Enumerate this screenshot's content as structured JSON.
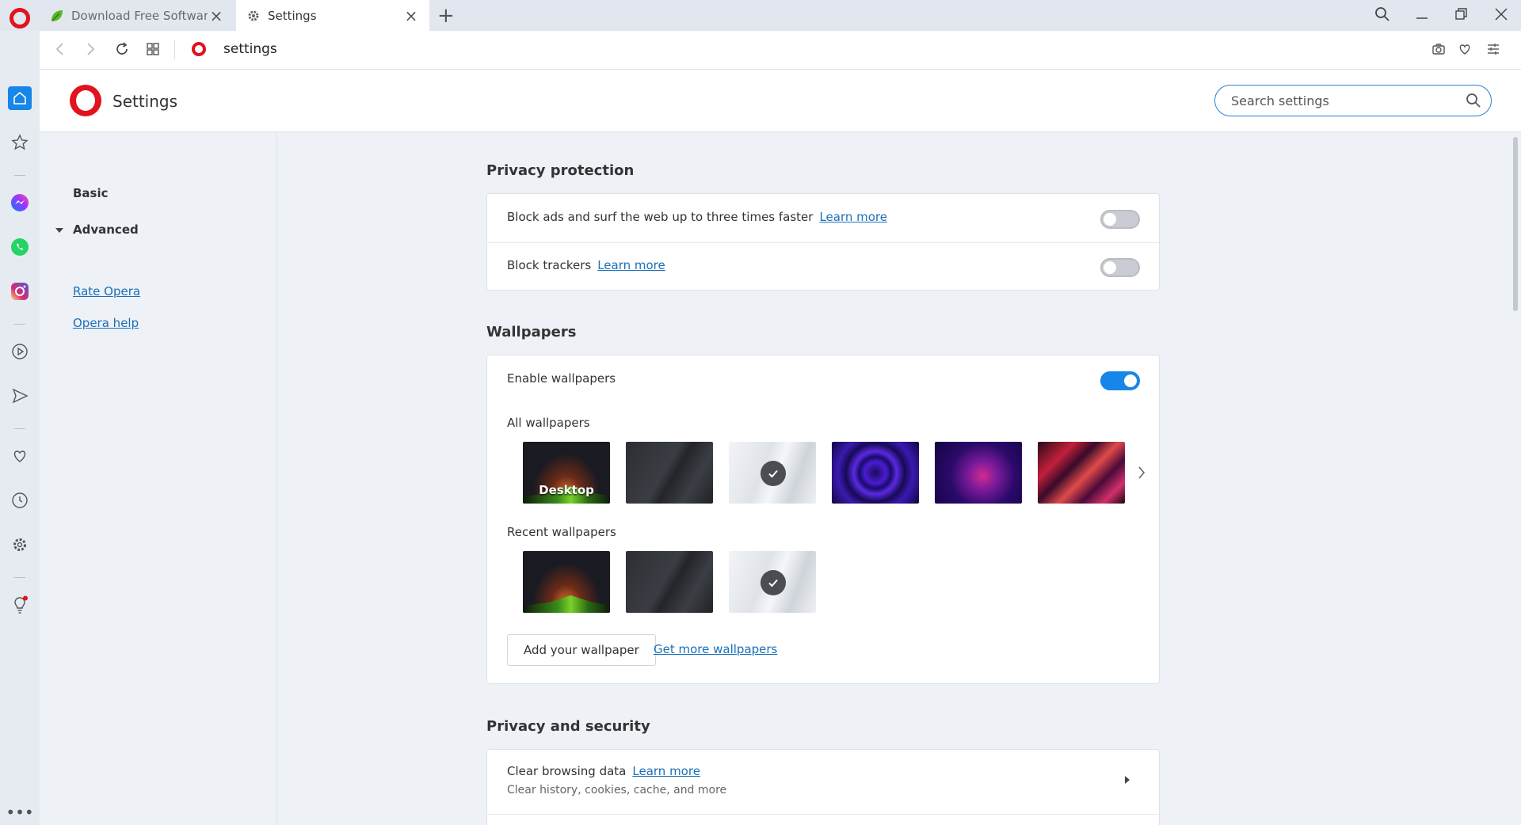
{
  "tabs": [
    {
      "title": "Download Free Software fo",
      "active": false
    },
    {
      "title": "Settings",
      "active": true
    }
  ],
  "address": {
    "url": "settings"
  },
  "header": {
    "title": "Settings"
  },
  "search": {
    "placeholder": "Search settings",
    "value": ""
  },
  "nav": {
    "basic": "Basic",
    "advanced": "Advanced",
    "rate": "Rate Opera",
    "help": "Opera help"
  },
  "privacy_protection": {
    "title": "Privacy protection",
    "block_ads": {
      "label": "Block ads and surf the web up to three times faster",
      "link": "Learn more",
      "enabled": false
    },
    "block_trackers": {
      "label": "Block trackers",
      "link": "Learn more",
      "enabled": false
    }
  },
  "wallpapers": {
    "title": "Wallpapers",
    "enable_label": "Enable wallpapers",
    "enabled": true,
    "all_label": "All wallpapers",
    "desktop_label": "Desktop",
    "recent_label": "Recent wallpapers",
    "add_button": "Add your wallpaper",
    "get_more": "Get more wallpapers"
  },
  "privacy_security": {
    "title": "Privacy and security",
    "clear_title": "Clear browsing data",
    "clear_link": "Learn more",
    "clear_sub": "Clear history, cookies, cache, and more"
  },
  "colors": {
    "accent": "#1786e8",
    "opera_red": "#e0131e",
    "link": "#1a6fb8"
  }
}
